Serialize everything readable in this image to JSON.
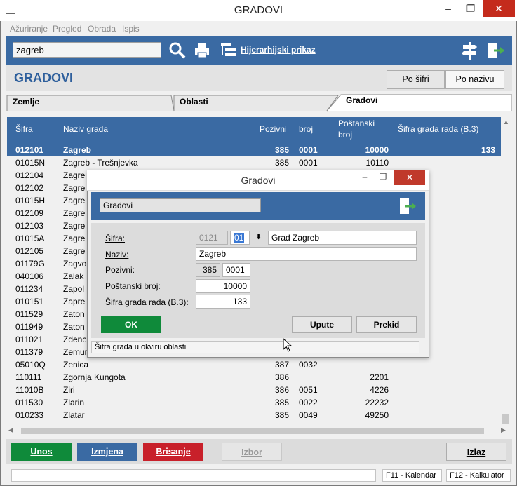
{
  "window": {
    "title": "GRADOVI"
  },
  "menu": {
    "items": [
      "Ažuriranje",
      "Pregled",
      "Obrada",
      "Ispis"
    ]
  },
  "toolbar": {
    "search_value": "zagreb",
    "hier_label": "Hijerarhijski prikaz"
  },
  "header": {
    "title": "GRADOVI",
    "sort_by_code": "Po šifri",
    "sort_by_name": "Po nazivu"
  },
  "tabs": [
    "Zemlje",
    "Oblasti",
    "Gradovi"
  ],
  "grid": {
    "columns": {
      "sifra": "Šifra",
      "naziv": "Naziv grada",
      "pozivni": "Pozivni",
      "broj": "broj",
      "postanski": "Poštanski broj",
      "sifra_rada": "Šifra grada rada (B.3)"
    },
    "rows": [
      {
        "sifra": "012101",
        "naziv": "Zagreb",
        "pozivni": "385",
        "broj": "0001",
        "postanski": "10000",
        "rada": "133"
      },
      {
        "sifra": "01015N",
        "naziv": "Zagreb - Trešnjevka",
        "pozivni": "385",
        "broj": "0001",
        "postanski": "10110",
        "rada": ""
      },
      {
        "sifra": "012104",
        "naziv": "Zagre",
        "pozivni": "",
        "broj": "",
        "postanski": "",
        "rada": ""
      },
      {
        "sifra": "012102",
        "naziv": "Zagre",
        "pozivni": "",
        "broj": "",
        "postanski": "",
        "rada": ""
      },
      {
        "sifra": "01015H",
        "naziv": "Zagre",
        "pozivni": "",
        "broj": "",
        "postanski": "",
        "rada": ""
      },
      {
        "sifra": "012109",
        "naziv": "Zagre",
        "pozivni": "",
        "broj": "",
        "postanski": "",
        "rada": ""
      },
      {
        "sifra": "012103",
        "naziv": "Zagre",
        "pozivni": "",
        "broj": "",
        "postanski": "",
        "rada": ""
      },
      {
        "sifra": "01015A",
        "naziv": "Zagre",
        "pozivni": "",
        "broj": "",
        "postanski": "",
        "rada": ""
      },
      {
        "sifra": "012105",
        "naziv": "Zagre",
        "pozivni": "",
        "broj": "",
        "postanski": "",
        "rada": ""
      },
      {
        "sifra": "01179G",
        "naziv": "Zagvo",
        "pozivni": "",
        "broj": "",
        "postanski": "",
        "rada": ""
      },
      {
        "sifra": "040106",
        "naziv": "Zalak",
        "pozivni": "",
        "broj": "",
        "postanski": "",
        "rada": ""
      },
      {
        "sifra": "011234",
        "naziv": "Zapol",
        "pozivni": "",
        "broj": "",
        "postanski": "",
        "rada": ""
      },
      {
        "sifra": "010151",
        "naziv": "Zapre",
        "pozivni": "",
        "broj": "",
        "postanski": "",
        "rada": ""
      },
      {
        "sifra": "011529",
        "naziv": "Zaton",
        "pozivni": "",
        "broj": "",
        "postanski": "",
        "rada": ""
      },
      {
        "sifra": "011949",
        "naziv": "Zaton",
        "pozivni": "",
        "broj": "",
        "postanski": "",
        "rada": ""
      },
      {
        "sifra": "011021",
        "naziv": "Zdenc",
        "pozivni": "",
        "broj": "",
        "postanski": "",
        "rada": ""
      },
      {
        "sifra": "011379",
        "naziv": "Zemur",
        "pozivni": "",
        "broj": "",
        "postanski": "",
        "rada": ""
      },
      {
        "sifra": "05010Q",
        "naziv": "Zenica",
        "pozivni": "387",
        "broj": "0032",
        "postanski": "",
        "rada": ""
      },
      {
        "sifra": "110111",
        "naziv": "Zgornja Kungota",
        "pozivni": "386",
        "broj": "",
        "postanski": "2201",
        "rada": ""
      },
      {
        "sifra": "11010B",
        "naziv": "Ziri",
        "pozivni": "386",
        "broj": "0051",
        "postanski": "4226",
        "rada": ""
      },
      {
        "sifra": "011530",
        "naziv": "Zlarin",
        "pozivni": "385",
        "broj": "0022",
        "postanski": "22232",
        "rada": ""
      },
      {
        "sifra": "010233",
        "naziv": "Zlatar",
        "pozivni": "385",
        "broj": "0049",
        "postanski": "49250",
        "rada": ""
      }
    ]
  },
  "actions": {
    "unos": "Unos",
    "izmjena": "Izmjena",
    "brisanje": "Brisanje",
    "izbor": "Izbor",
    "izlaz": "Izlaz"
  },
  "status": {
    "f11": "F11 - Kalendar",
    "f12": "F12 - Kalkulator"
  },
  "dialog": {
    "title": "Gradovi",
    "header_label": "Gradovi",
    "labels": {
      "sifra": "Šifra:",
      "naziv": "Naziv:",
      "pozivni": "Pozivni:",
      "postanski": "Poštanski broj:",
      "sifra_rada": "Šifra grada rada (B.3):"
    },
    "values": {
      "sifra_prefix": "0121",
      "sifra_suffix": "01",
      "oblast": "Grad Zagreb",
      "naziv": "Zagreb",
      "pozivni": "385",
      "broj": "0001",
      "postanski": "10000",
      "sifra_rada": "133"
    },
    "buttons": {
      "ok": "OK",
      "upute": "Upute",
      "prekid": "Prekid"
    },
    "hint": "Šifra grada u okviru oblasti"
  },
  "colors": {
    "accent": "#3a6aa3",
    "selected_row": "#3a6aa3",
    "unos": "#0f8a3a",
    "izmjena": "#3a6aa3",
    "brisanje": "#c8202a",
    "dialog_close": "#c0392b",
    "title": "#2e5f9c"
  }
}
